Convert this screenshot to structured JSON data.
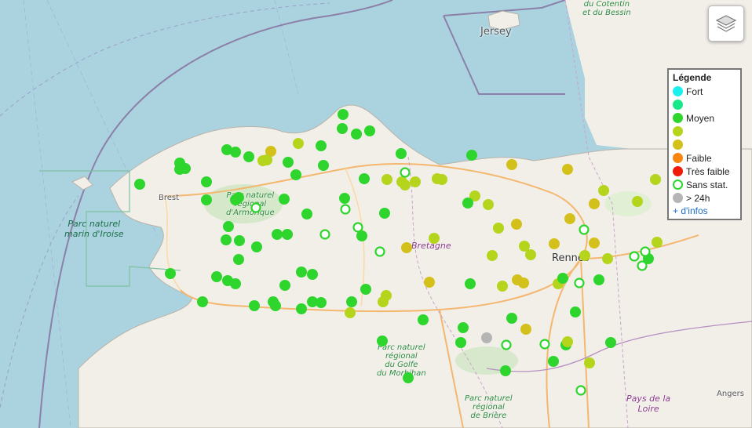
{
  "map": {
    "labels": {
      "jersey": "Jersey",
      "brest": "Brest",
      "rennes": "Rennes",
      "angers": "Angers",
      "bretagne": "Bretagne",
      "pays_loire": "Pays de la\nLoire",
      "cotentin": "du Cotentin\net du Bessin",
      "parc_iroise": "Parc naturel\nmarin d'Iroise",
      "parc_armorique": "Parc naturel\nrégional\nd'Armorique",
      "parc_morbihan": "Parc naturel\nrégional\ndu Golfe\ndu Morbihan",
      "parc_briere": "Parc naturel\nrégional\nde Brière"
    }
  },
  "legend": {
    "title": "Légende",
    "items": [
      {
        "label": "Fort",
        "color": "#19f0ee",
        "hollow": false
      },
      {
        "label": "",
        "color": "#19e888",
        "hollow": false
      },
      {
        "label": "Moyen",
        "color": "#2dd52d",
        "hollow": false
      },
      {
        "label": "",
        "color": "#b5d41c",
        "hollow": false
      },
      {
        "label": "",
        "color": "#d4c01b",
        "hollow": false
      },
      {
        "label": "Faible",
        "color": "#f7860e",
        "hollow": false
      },
      {
        "label": "Très faible",
        "color": "#f01a0a",
        "hollow": false
      },
      {
        "label": "Sans stat.",
        "color": "#2dd52d",
        "hollow": true
      },
      {
        "label": "> 24h",
        "color": "#b5b5b5",
        "hollow": false
      }
    ],
    "link": "+ d'infos"
  },
  "controls": {
    "layers_icon": "layers-icon"
  }
}
